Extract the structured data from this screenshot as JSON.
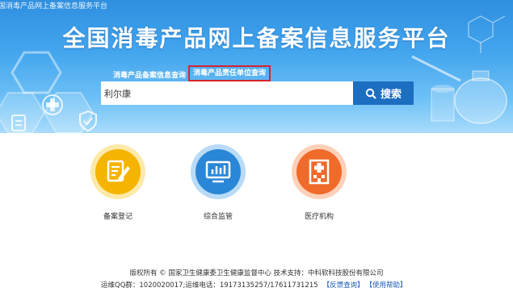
{
  "header": {
    "small_title": "国消毒产品网上备案信息服务平台",
    "title": "全国消毒产品网上备案信息服务平台"
  },
  "tabs": [
    {
      "label": "消毒产品备案信息查询",
      "selected": false
    },
    {
      "label": "消毒产品责任单位查询",
      "selected": true
    }
  ],
  "search": {
    "value": "利尔康",
    "button_label": "搜索"
  },
  "categories": [
    {
      "label": "备案登记",
      "icon": "edit-document-icon",
      "color": "#f5b400"
    },
    {
      "label": "综合监管",
      "icon": "monitor-chart-icon",
      "color": "#2a86d6"
    },
    {
      "label": "医疗机构",
      "icon": "hospital-icon",
      "color": "#f06a2a"
    }
  ],
  "footer": {
    "copyright": "版权所有 © 国家卫生健康委卫生健康监督中心  技术支持：中科软科技股份有限公司",
    "contact": "运维QQ群：1020020017;运维电话：19173135257/17611731215",
    "feedback_link": "【反馈查询】",
    "help_link": "【使用帮助】"
  },
  "colors": {
    "banner": "#44a6ee",
    "search_button": "#1c6ec0",
    "tab_highlight_border": "#d9232d",
    "link": "#1a5bb8"
  }
}
